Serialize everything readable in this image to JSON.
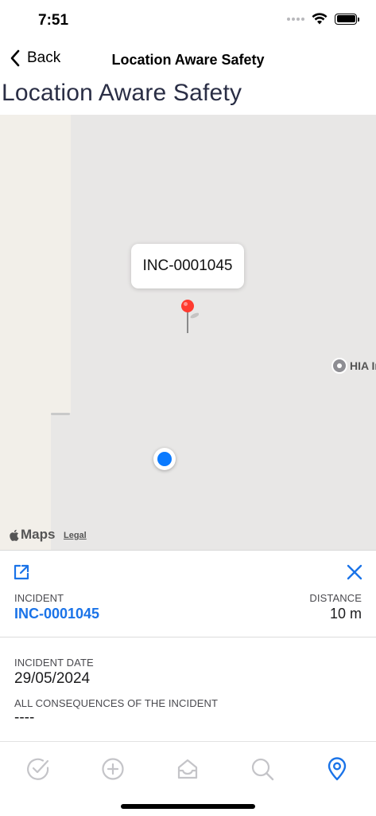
{
  "status_bar": {
    "time": "7:51"
  },
  "nav": {
    "back_label": "Back",
    "title": "Location Aware Safety"
  },
  "page": {
    "title": "Location Aware Safety"
  },
  "map": {
    "callout_label": "INC-0001045",
    "poi_label": "HIA In",
    "brand": "Maps",
    "legal": "Legal"
  },
  "incident_panel": {
    "incident_label": "INCIDENT",
    "incident_value": "INC-0001045",
    "distance_label": "DISTANCE",
    "distance_value": "10 m",
    "date_label": "INCIDENT DATE",
    "date_value": "29/05/2024",
    "consequences_label": "ALL CONSEQUENCES OF THE INCIDENT",
    "consequences_value": "----"
  },
  "tab_bar": {
    "tabs": [
      {
        "icon": "check-circle-icon",
        "active": false
      },
      {
        "icon": "plus-circle-icon",
        "active": false
      },
      {
        "icon": "inbox-icon",
        "active": false
      },
      {
        "icon": "search-icon",
        "active": false
      },
      {
        "icon": "location-pin-icon",
        "active": true
      }
    ]
  },
  "colors": {
    "accent": "#1a73e8",
    "tab_inactive": "#c4c4c8",
    "pin": "#ff3b30",
    "user_location": "#0a7aff",
    "title_text": "#2a2e45"
  }
}
